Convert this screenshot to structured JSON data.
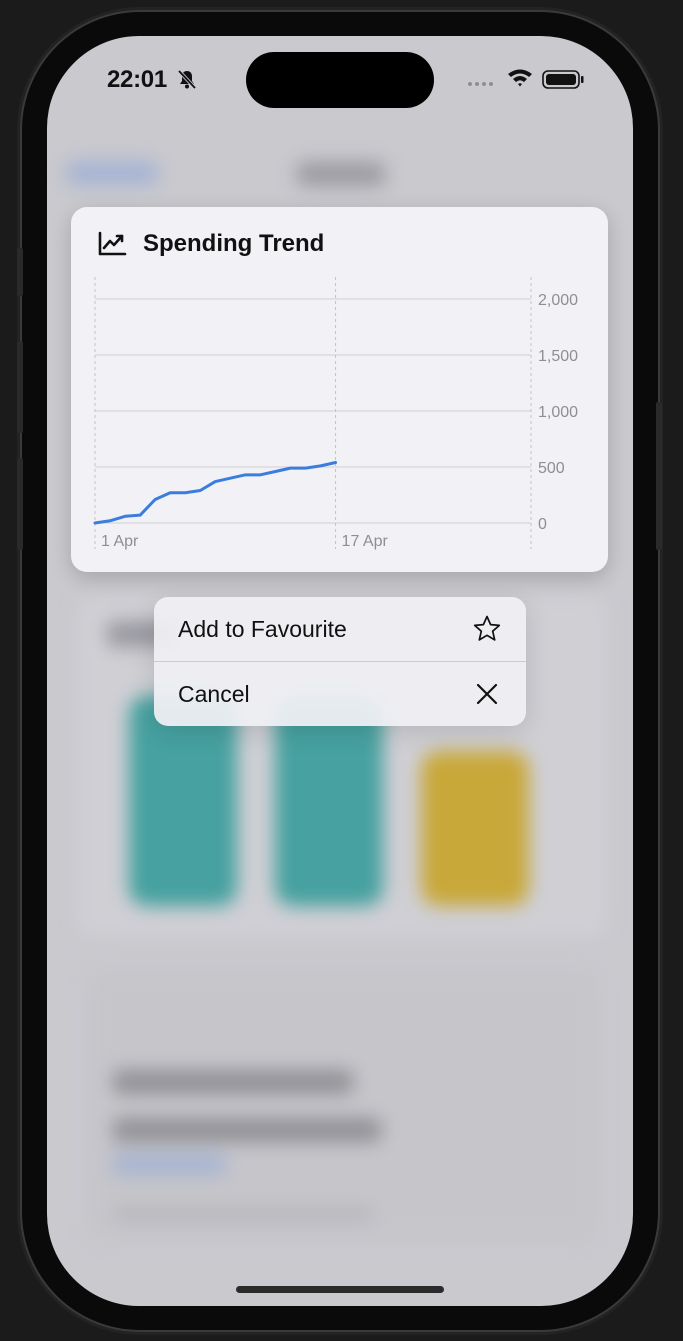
{
  "status_bar": {
    "time": "22:01",
    "icons": [
      "bell-slash-icon",
      "cellular-icon",
      "wifi-icon",
      "battery-icon"
    ]
  },
  "card": {
    "title": "Spending Trend",
    "icon": "chart-line-uptrend-icon"
  },
  "chart_data": {
    "type": "line",
    "x_tick_labels": [
      "1 Apr",
      "17 Apr"
    ],
    "y_tick_labels": [
      "2,000",
      "1,500",
      "1,000",
      "500",
      "0"
    ],
    "y_ticks": [
      2000,
      1500,
      1000,
      500,
      0
    ],
    "ylim": [
      0,
      2000
    ],
    "xlim": [
      1,
      30
    ],
    "grid": true,
    "color": "#3b7ddd",
    "series": [
      {
        "x": [
          1,
          2,
          3,
          4,
          5,
          6,
          7,
          8,
          9,
          10,
          11,
          12,
          13,
          14,
          15,
          16,
          17
        ],
        "y": [
          0,
          20,
          60,
          70,
          210,
          270,
          270,
          290,
          370,
          400,
          430,
          430,
          460,
          490,
          490,
          510,
          540
        ]
      }
    ]
  },
  "context_menu": {
    "items": [
      {
        "label": "Add to Favourite",
        "icon": "star-icon"
      },
      {
        "label": "Cancel",
        "icon": "close-icon"
      }
    ]
  },
  "colors": {
    "accent_line": "#3b7ddd",
    "teal_tile": "#46a1a0",
    "yellow_tile": "#c9a83a"
  }
}
